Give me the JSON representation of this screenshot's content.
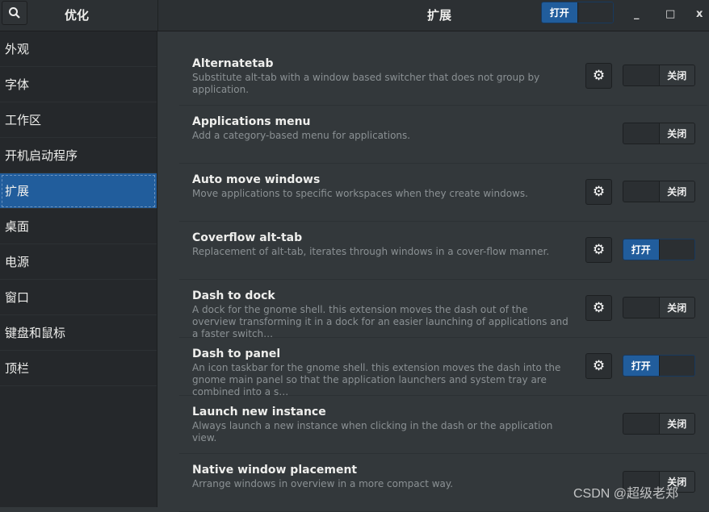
{
  "header": {
    "app_title": "优化",
    "main_title": "扩展",
    "global_switch": {
      "on": true,
      "on_label": "打开",
      "off_label": "关闭"
    },
    "minimize": "_",
    "maximize": "□",
    "close": "x"
  },
  "sidebar": {
    "items": [
      {
        "label": "外观"
      },
      {
        "label": "字体"
      },
      {
        "label": "工作区"
      },
      {
        "label": "开机启动程序"
      },
      {
        "label": "扩展",
        "selected": true
      },
      {
        "label": "桌面"
      },
      {
        "label": "电源"
      },
      {
        "label": "窗口"
      },
      {
        "label": "键盘和鼠标"
      },
      {
        "label": "顶栏"
      }
    ]
  },
  "extensions": [
    {
      "name": "Alternatetab",
      "desc": "Substitute alt-tab with a window based switcher that does not group by application.",
      "has_settings": true,
      "on": false
    },
    {
      "name": "Applications menu",
      "desc": "Add a category-based menu for applications.",
      "has_settings": false,
      "on": false
    },
    {
      "name": "Auto move windows",
      "desc": "Move applications to specific workspaces when they create windows.",
      "has_settings": true,
      "on": false
    },
    {
      "name": "Coverflow alt-tab",
      "desc": "Replacement of alt-tab, iterates through windows in a cover-flow manner.",
      "has_settings": true,
      "on": true
    },
    {
      "name": "Dash to dock",
      "desc": "A dock for the gnome shell. this extension moves the dash out of the overview transforming it in a dock for an easier launching of applications and a faster switch…",
      "has_settings": true,
      "on": false
    },
    {
      "name": "Dash to panel",
      "desc": "An icon taskbar for the gnome shell. this extension moves the dash into the gnome main panel so that the application launchers and system tray are combined into a s…",
      "has_settings": true,
      "on": true
    },
    {
      "name": "Launch new instance",
      "desc": "Always launch a new instance when clicking in the dash or the application view.",
      "has_settings": false,
      "on": false
    },
    {
      "name": "Native window placement",
      "desc": "Arrange windows in overview in a more compact way.",
      "has_settings": false,
      "on": false
    }
  ],
  "labels": {
    "on": "打开",
    "off": "关闭"
  },
  "watermark": "CSDN @超级老郑",
  "colors": {
    "accent": "#215d9c",
    "sidebar_bg": "#25282b",
    "main_bg": "#33383b"
  }
}
